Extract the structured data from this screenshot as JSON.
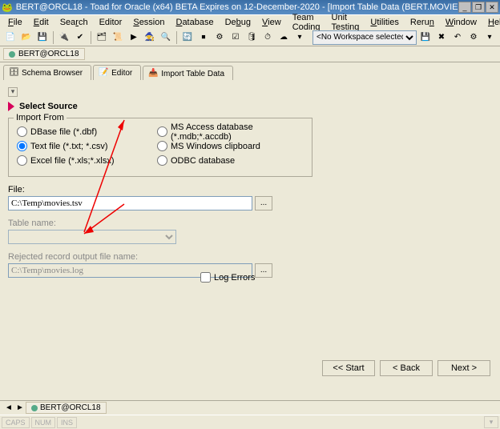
{
  "title": "BERT@ORCL18 - Toad for Oracle (x64)  BETA Expires on 12-December-2020 - [Import Table Data (BERT.MOVIES)]",
  "menu": {
    "file": "File",
    "edit": "Edit",
    "search": "Search",
    "editor": "Editor",
    "session": "Session",
    "database": "Database",
    "debug": "Debug",
    "view": "View",
    "teamcoding": "Team Coding",
    "unittesting": "Unit Testing",
    "utilities": "Utilities",
    "rerun": "Rerun",
    "window": "Window",
    "help": "Help"
  },
  "workspace": {
    "placeholder": "<No Workspace selected>"
  },
  "connection": "BERT@ORCL18",
  "tabs": {
    "schema": "Schema Browser",
    "editor": "Editor",
    "import": "Import Table Data"
  },
  "wizard": {
    "title": "Select Source",
    "group": "Import From",
    "radios": {
      "dbase": "DBase file (*.dbf)",
      "text": "Text file (*.txt; *.csv)",
      "excel": "Excel file (*.xls;*.xlsx)",
      "access": "MS Access database (*.mdb;*.accdb)",
      "clipboard": "MS Windows clipboard",
      "odbc": "ODBC database"
    },
    "file_label": "File:",
    "file_value": "C:\\Temp\\movies.tsv",
    "table_label": "Table name:",
    "reject_label": "Rejected record output file name:",
    "reject_value": "C:\\Temp\\movies.log",
    "logerrors": "Log Errors"
  },
  "nav": {
    "start": "<< Start",
    "back": "< Back",
    "next": "Next >"
  },
  "footer_tab": "BERT@ORCL18",
  "status": {
    "caps": "CAPS",
    "num": "NUM",
    "ins": "INS"
  }
}
